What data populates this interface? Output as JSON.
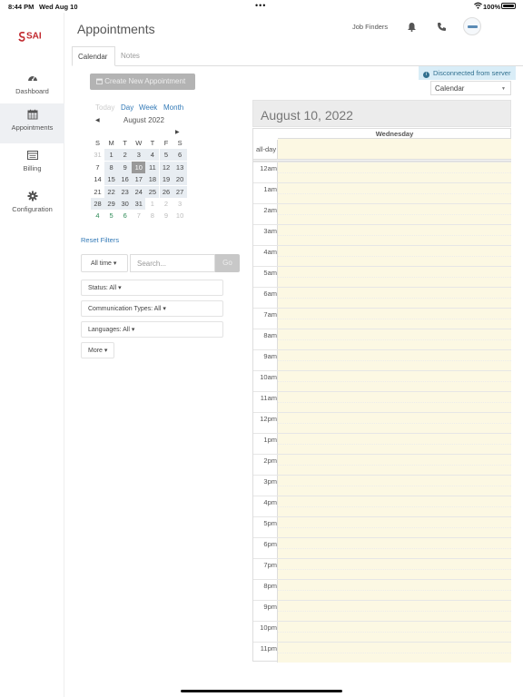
{
  "status_bar": {
    "time": "8:44 PM",
    "date": "Wed Aug 10",
    "dots": "•••",
    "battery": "100%"
  },
  "sidebar": {
    "logo": "SAI",
    "items": [
      {
        "label": "Dashboard",
        "icon": "dashboard-icon",
        "active": false
      },
      {
        "label": "Appointments",
        "icon": "calendar-icon",
        "active": true
      },
      {
        "label": "Billing",
        "icon": "billing-icon",
        "active": false
      },
      {
        "label": "Configuration",
        "icon": "gear-icon",
        "active": false
      }
    ]
  },
  "header": {
    "title": "Appointments",
    "company": "Job Finders"
  },
  "tabs": [
    {
      "label": "Calendar",
      "active": true
    },
    {
      "label": "Notes",
      "active": false
    }
  ],
  "toolbar": {
    "create_label": "Create New Appointment",
    "connection_status": "Disconnected from server",
    "view_select": "Calendar"
  },
  "mini_calendar": {
    "nav": {
      "today": "Today",
      "day": "Day",
      "week": "Week",
      "month": "Month"
    },
    "title": "August 2022",
    "weekdays": [
      "S",
      "M",
      "T",
      "W",
      "T",
      "F",
      "S"
    ],
    "weeks": [
      [
        "31",
        "1",
        "2",
        "3",
        "4",
        "5",
        "6"
      ],
      [
        "7",
        "8",
        "9",
        "10",
        "11",
        "12",
        "13"
      ],
      [
        "14",
        "15",
        "16",
        "17",
        "18",
        "19",
        "20"
      ],
      [
        "21",
        "22",
        "23",
        "24",
        "25",
        "26",
        "27"
      ],
      [
        "28",
        "29",
        "30",
        "31",
        "1",
        "2",
        "3"
      ],
      [
        "4",
        "5",
        "6",
        "7",
        "8",
        "9",
        "10"
      ]
    ],
    "selected": "10"
  },
  "filters": {
    "reset_label": "Reset Filters",
    "time_label": "All time ▾",
    "search_placeholder": "Search...",
    "go_label": "Go",
    "status_label": "Status: All ▾",
    "communication_label": "Communication Types: All ▾",
    "languages_label": "Languages: All ▾",
    "more_label": "More ▾"
  },
  "day_view": {
    "date_title": "August 10, 2022",
    "weekday": "Wednesday",
    "allday_label": "all-day",
    "hours": [
      "12am",
      "1am",
      "2am",
      "3am",
      "4am",
      "5am",
      "6am",
      "7am",
      "8am",
      "9am",
      "10am",
      "11am",
      "12pm",
      "1pm",
      "2pm",
      "3pm",
      "4pm",
      "5pm",
      "6pm",
      "7pm",
      "8pm",
      "9pm",
      "10pm",
      "11pm"
    ]
  },
  "colors": {
    "accent": "#337ab7",
    "logo": "#c1272d",
    "today_bg": "#fcf8e3",
    "info_bg": "#d9edf7"
  }
}
